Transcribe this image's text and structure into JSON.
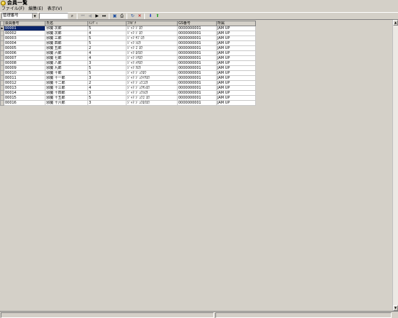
{
  "window": {
    "title": "会員一覧"
  },
  "menu": [
    "ファイル(F)",
    "編集(E)",
    "表示(V)"
  ],
  "toolbar": {
    "sort_select": {
      "value": "管理番号"
    },
    "search_input": {
      "value": ""
    },
    "buttons": [
      {
        "name": "search-icon",
        "glyph": "⌕",
        "disabled": false
      },
      {
        "sep": true
      },
      {
        "name": "first-record-icon",
        "glyph": "⏮",
        "disabled": true
      },
      {
        "name": "prev-record-icon",
        "glyph": "◀",
        "disabled": true
      },
      {
        "name": "next-record-icon",
        "glyph": "▶",
        "disabled": false
      },
      {
        "name": "last-record-icon",
        "glyph": "⏭",
        "disabled": false
      },
      {
        "sep": true
      },
      {
        "name": "save-icon",
        "glyph": "▣",
        "disabled": false,
        "color": "#1f4fa0"
      },
      {
        "name": "print-icon",
        "glyph": "⎙",
        "disabled": false
      },
      {
        "sep": true
      },
      {
        "name": "refresh-icon",
        "glyph": "↻",
        "disabled": false,
        "color": "#1f4fa0"
      },
      {
        "name": "delete-icon",
        "glyph": "✕",
        "disabled": false,
        "color": "#c00000"
      },
      {
        "sep": true
      },
      {
        "name": "move-down-icon",
        "glyph": "⬇",
        "disabled": false,
        "color": "#1f3fbf"
      },
      {
        "name": "move-up-icon",
        "glyph": "⬆",
        "disabled": false,
        "color": "#1f9f1f"
      }
    ]
  },
  "grid": {
    "columns": [
      "会員番号",
      "氏名",
      "ﾊﾝﾃﾞｨ",
      "ﾌﾘｶﾞﾅ",
      "GS番号",
      "所属"
    ],
    "rows": [
      [
        "00001",
        "邪魔 次郎",
        "5",
        "ｼﾞｬﾏ ｼﾞﾛｳ",
        "0000000001",
        "JAM UP"
      ],
      [
        "00002",
        "邪魔 次郎",
        "4",
        "ｼﾞｬﾏ ｼﾞﾛｳ",
        "0000000001",
        "JAM UP"
      ],
      [
        "00003",
        "邪魔 三郎",
        "5",
        "ｼﾞｬﾏ ｻﾌﾞﾛｳ",
        "0000000001",
        "JAM UP"
      ],
      [
        "00004",
        "邪魔 四郎",
        "5",
        "ｼﾞｬﾏ ｼﾛｳ",
        "0000000001",
        "JAM UP"
      ],
      [
        "00005",
        "邪魔 五郎",
        "2",
        "ｼﾞｬﾏ ｺﾞﾛｳ",
        "0000000001",
        "JAM UP"
      ],
      [
        "00006",
        "邪魔 六郎",
        "4",
        "ｼﾞｬﾏ ﾛｸﾛｳ",
        "0000000001",
        "JAM UP"
      ],
      [
        "00007",
        "邪魔 七郎",
        "4",
        "ｼﾞｬﾏ ｼﾁﾛｳ",
        "0000000001",
        "JAM UP"
      ],
      [
        "00008",
        "邪魔 八郎",
        "3",
        "ｼﾞｬﾏ ﾊﾁﾛｳ",
        "0000000001",
        "JAM UP"
      ],
      [
        "00009",
        "邪魔 九郎",
        "5",
        "ｼﾞｬﾏ ｸﾛｳ",
        "0000000001",
        "JAM UP"
      ],
      [
        "00010",
        "邪魔 十郎",
        "5",
        "ｼﾞｬﾏ ｼﾞｭｳﾛｳ",
        "0000000001",
        "JAM UP"
      ],
      [
        "00011",
        "邪魔 十一郎",
        "3",
        "ｼﾞｬﾏ ｼﾞｭｳｲﾁﾛｳ",
        "0000000001",
        "JAM UP"
      ],
      [
        "00012",
        "邪魔 十二郎",
        "2",
        "ｼﾞｬﾏ ｼﾞｭｳﾆﾛｳ",
        "0000000001",
        "JAM UP"
      ],
      [
        "00013",
        "邪魔 十三郎",
        "4",
        "ｼﾞｬﾏ ｼﾞｭｳｻﾝﾛｳ",
        "0000000001",
        "JAM UP"
      ],
      [
        "00014",
        "邪魔 十四郎",
        "3",
        "ｼﾞｬﾏ ｼﾞｭｳｼﾛｳ",
        "0000000001",
        "JAM UP"
      ],
      [
        "00015",
        "邪魔 十五郎",
        "5",
        "ｼﾞｬﾏ ｼﾞｭｳｺﾞﾛｳ",
        "0000000001",
        "JAM UP"
      ],
      [
        "00016",
        "邪魔 十六郎",
        "3",
        "ｼﾞｬﾏ ｼﾞｭｳﾛｸﾛｳ",
        "0000000001",
        "JAM UP"
      ]
    ],
    "current_row_marker": "▶"
  },
  "colors": {
    "face": "#d4d0c8",
    "selection": "#0a246a"
  }
}
